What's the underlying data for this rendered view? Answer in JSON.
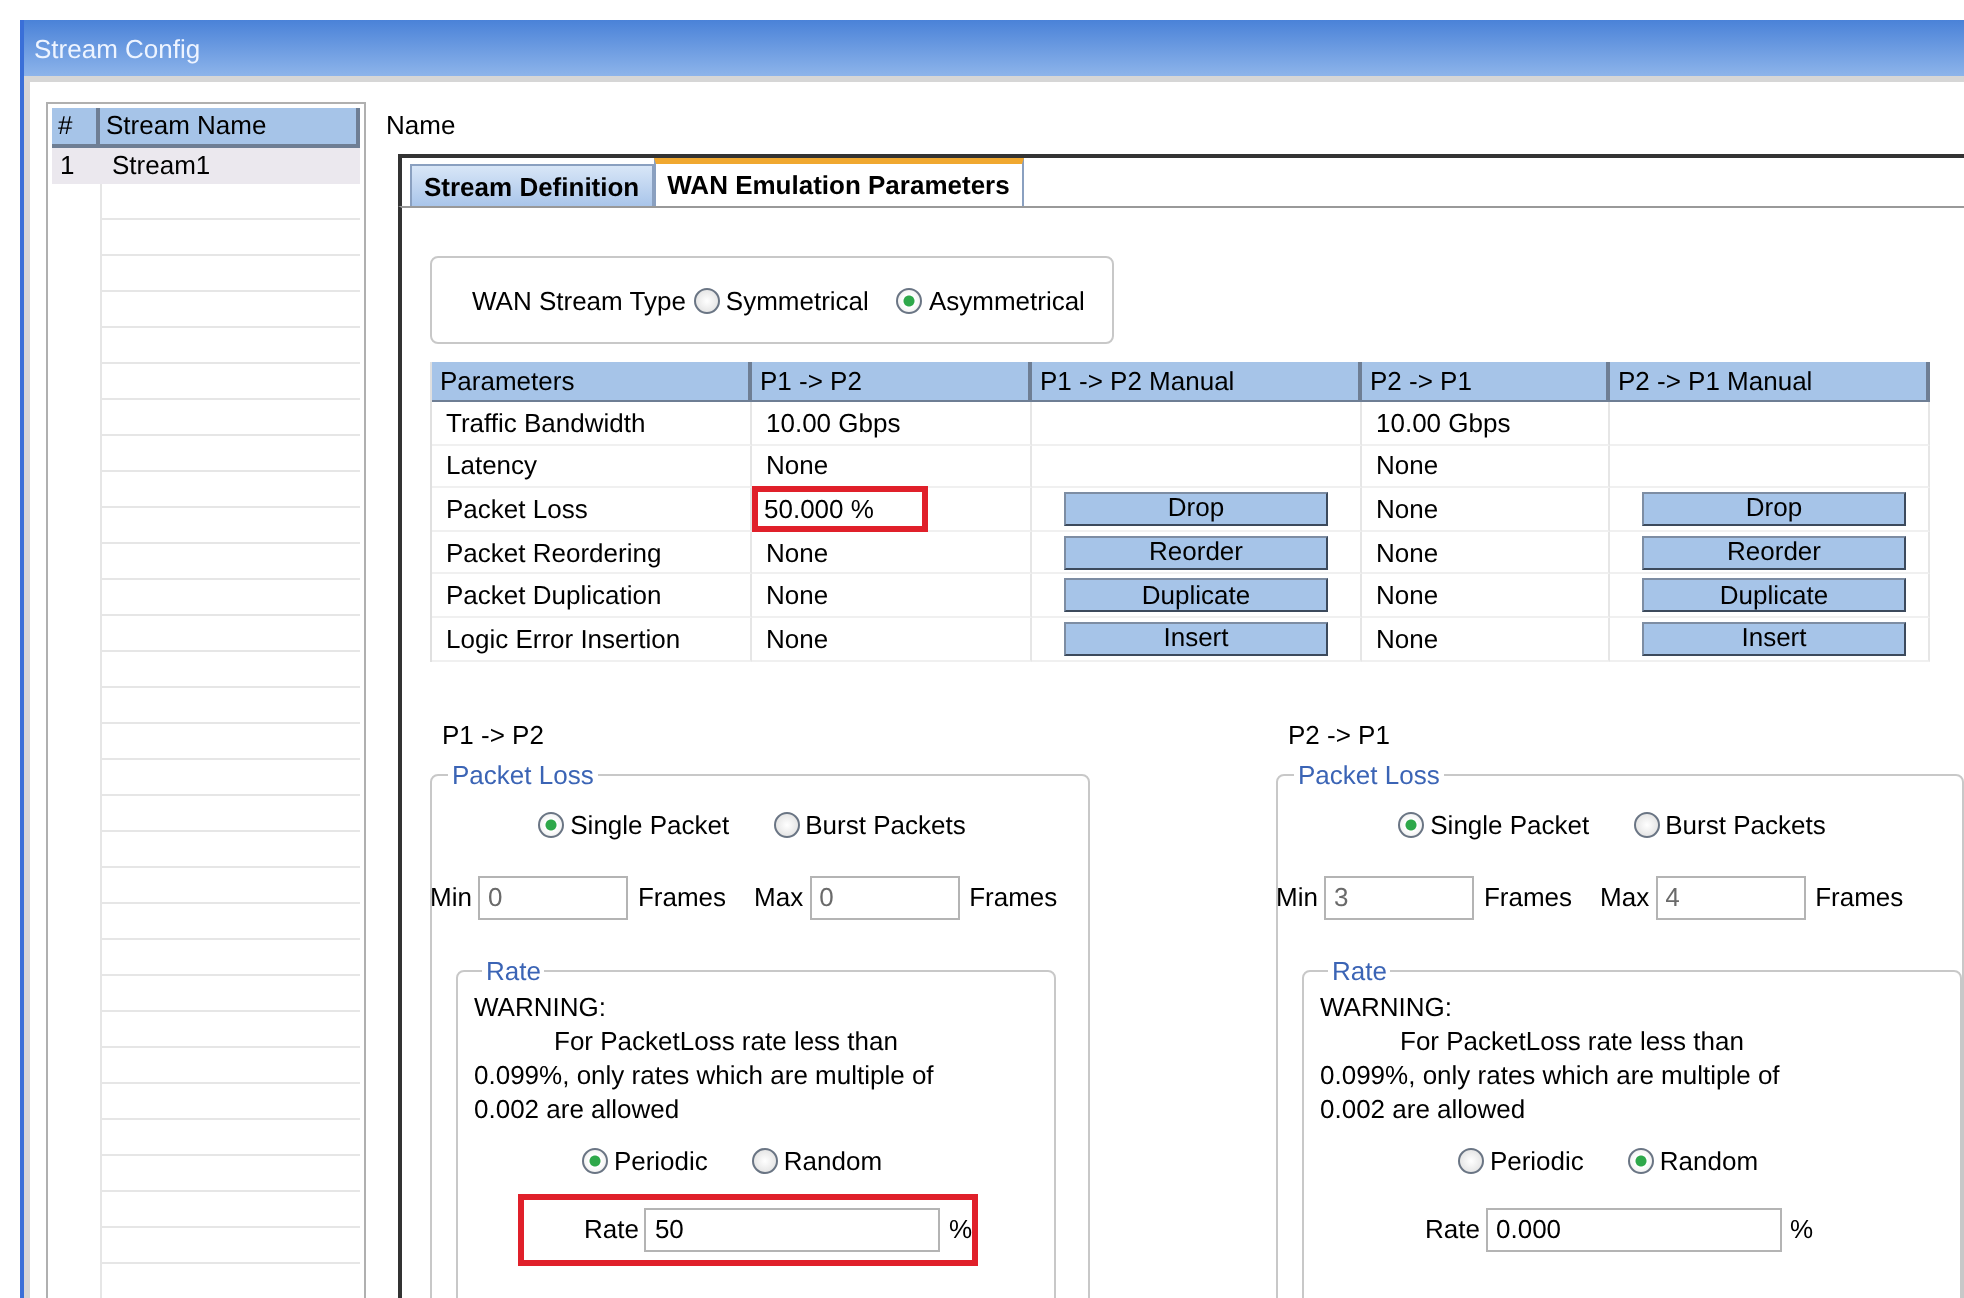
{
  "window": {
    "title": "Stream Config"
  },
  "stream_list": {
    "columns": [
      "#",
      "Stream Name"
    ],
    "rows": [
      {
        "cells": [
          "1",
          "Stream1"
        ],
        "selected": true
      }
    ]
  },
  "name_label": "Name",
  "tabs": [
    {
      "label": "Stream Definition",
      "selected": false
    },
    {
      "label": "WAN Emulation Parameters",
      "selected": true
    }
  ],
  "stream_type": {
    "label": "WAN Stream Type",
    "options": [
      {
        "label": "Symmetrical",
        "selected": false
      },
      {
        "label": "Asymmetrical",
        "selected": true
      }
    ]
  },
  "params_table": {
    "columns": [
      "Parameters",
      "P1 -> P2",
      "P1 -> P2 Manual",
      "P2 -> P1",
      "P2 -> P1 Manual"
    ],
    "rows": [
      {
        "cells": [
          {
            "kind": "text",
            "text": "Traffic Bandwidth"
          },
          {
            "kind": "text",
            "text": "10.00 Gbps"
          },
          {
            "kind": "blank"
          },
          {
            "kind": "text",
            "text": "10.00 Gbps"
          },
          {
            "kind": "blank"
          }
        ]
      },
      {
        "cells": [
          {
            "kind": "text",
            "text": "Latency"
          },
          {
            "kind": "text",
            "text": "None"
          },
          {
            "kind": "blank"
          },
          {
            "kind": "text",
            "text": "None"
          },
          {
            "kind": "blank"
          }
        ]
      },
      {
        "cells": [
          {
            "kind": "text",
            "text": "Packet Loss"
          },
          {
            "kind": "text",
            "text": "50.000 %",
            "highlighted": true
          },
          {
            "kind": "button",
            "text": "Drop"
          },
          {
            "kind": "text",
            "text": "None"
          },
          {
            "kind": "button",
            "text": "Drop"
          }
        ]
      },
      {
        "cells": [
          {
            "kind": "text",
            "text": "Packet Reordering"
          },
          {
            "kind": "text",
            "text": "None"
          },
          {
            "kind": "button",
            "text": "Reorder"
          },
          {
            "kind": "text",
            "text": "None"
          },
          {
            "kind": "button",
            "text": "Reorder"
          }
        ]
      },
      {
        "cells": [
          {
            "kind": "text",
            "text": "Packet Duplication"
          },
          {
            "kind": "text",
            "text": "None"
          },
          {
            "kind": "button",
            "text": "Duplicate"
          },
          {
            "kind": "text",
            "text": "None"
          },
          {
            "kind": "button",
            "text": "Duplicate"
          }
        ]
      },
      {
        "cells": [
          {
            "kind": "text",
            "text": "Logic Error Insertion"
          },
          {
            "kind": "text",
            "text": "None"
          },
          {
            "kind": "button",
            "text": "Insert"
          },
          {
            "kind": "text",
            "text": "None"
          },
          {
            "kind": "button",
            "text": "Insert"
          }
        ]
      }
    ]
  },
  "directions": [
    {
      "heading": "P1 -> P2",
      "packet_loss": {
        "legend": "Packet Loss",
        "modes": [
          {
            "label": "Single Packet",
            "selected": true
          },
          {
            "label": "Burst Packets",
            "selected": false
          }
        ],
        "min": {
          "label": "Min",
          "value": "0",
          "unit": "Frames"
        },
        "max": {
          "label": "Max",
          "value": "0",
          "unit": "Frames"
        }
      },
      "rate": {
        "legend": "Rate",
        "warning_title": "WARNING:",
        "warning_text": "For PacketLoss rate less than\n0.099%, only rates which are multiple of\n0.002 are allowed",
        "modes": [
          {
            "label": "Periodic",
            "selected": true
          },
          {
            "label": "Random",
            "selected": false
          }
        ],
        "field": {
          "label": "Rate",
          "value": "50",
          "unit": "%",
          "highlighted": true
        }
      }
    },
    {
      "heading": "P2 -> P1",
      "packet_loss": {
        "legend": "Packet Loss",
        "modes": [
          {
            "label": "Single Packet",
            "selected": true
          },
          {
            "label": "Burst Packets",
            "selected": false
          }
        ],
        "min": {
          "label": "Min",
          "value": "3",
          "unit": "Frames"
        },
        "max": {
          "label": "Max",
          "value": "4",
          "unit": "Frames"
        }
      },
      "rate": {
        "legend": "Rate",
        "warning_title": "WARNING:",
        "warning_text": "For PacketLoss rate less than\n0.099%, only rates which are multiple of\n0.002 are allowed",
        "modes": [
          {
            "label": "Periodic",
            "selected": false
          },
          {
            "label": "Random",
            "selected": true
          }
        ],
        "field": {
          "label": "Rate",
          "value": "0.000",
          "unit": "%",
          "highlighted": false
        }
      }
    }
  ]
}
